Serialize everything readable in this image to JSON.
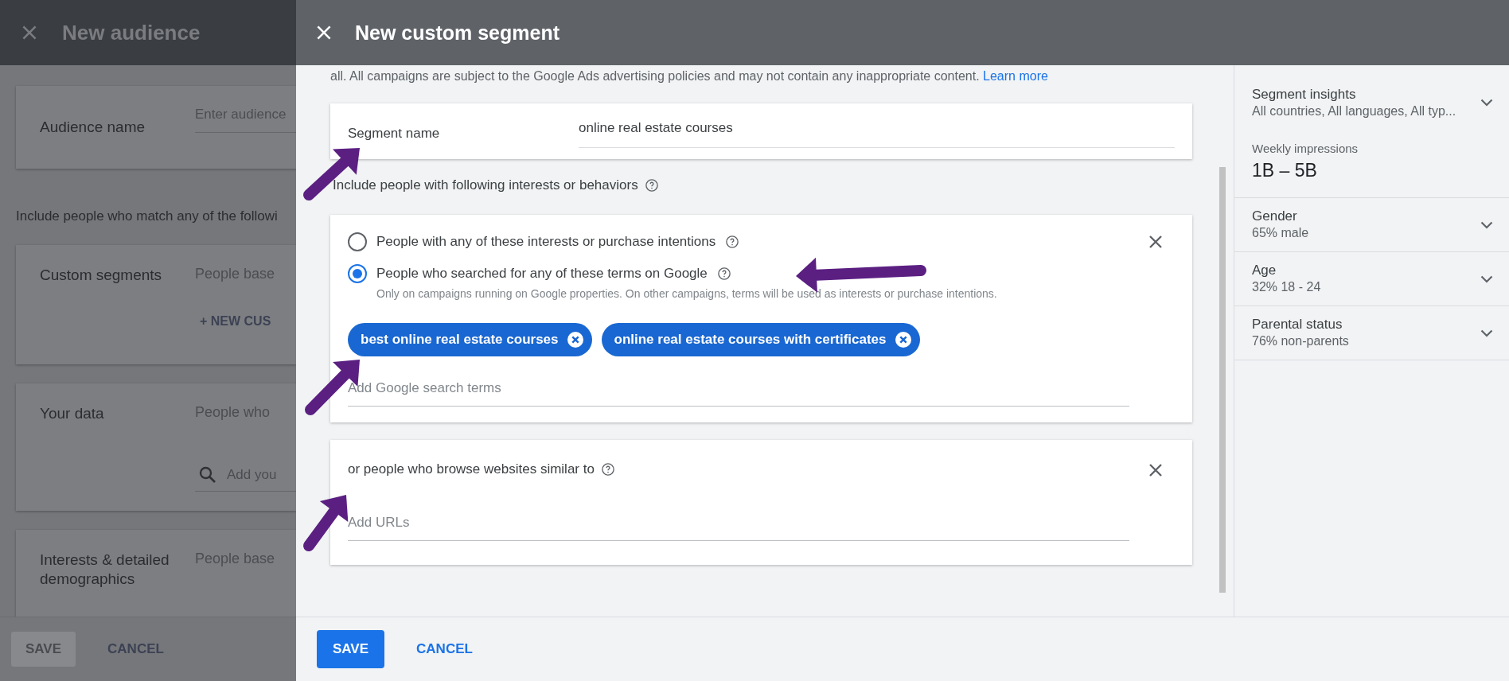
{
  "background_dialog": {
    "title": "New audience",
    "audience_name": {
      "label": "Audience name",
      "placeholder": "Enter audience"
    },
    "intro": "Include people who match any of the followi",
    "sections": [
      {
        "kind": "action",
        "label": "Custom segments",
        "description": "People base",
        "action": "+ NEW CUS"
      },
      {
        "kind": "search",
        "label": "Your data",
        "description": "People who",
        "placeholder": "Add you"
      },
      {
        "kind": "plain",
        "label": "Interests & detailed demographics",
        "description": "People base"
      }
    ],
    "buttons": [
      {
        "label": "SAVE",
        "disabled": true
      },
      {
        "label": "CANCEL",
        "disabled": false
      }
    ]
  },
  "dialog": {
    "title": "New custom segment",
    "notice": "all. All campaigns are subject to the Google Ads advertising policies and may not contain any inappropriate content.",
    "notice_link": "Learn more",
    "segment_name": {
      "label": "Segment name",
      "value": "online real estate courses"
    },
    "include_label": "Include people with following interests or behaviors",
    "interests_card": {
      "options": [
        {
          "label": "People with any of these interests or purchase intentions",
          "selected": false
        },
        {
          "label": "People who searched for any of these terms on Google",
          "selected": true
        }
      ],
      "note": "Only on campaigns running on Google properties. On other campaigns, terms will be used as interests or purchase intentions.",
      "terms": [
        "best online real estate courses",
        "online real estate courses with certificates"
      ],
      "placeholder": "Add Google search terms"
    },
    "websites_card": {
      "label": "or people who browse websites similar to",
      "placeholder": "Add URLs"
    },
    "insights": [
      {
        "kind": "summary",
        "title": "Segment insights",
        "value": "All countries, All languages, All typ..."
      },
      {
        "kind": "metric",
        "title": "Weekly impressions",
        "value": "1B – 5B"
      },
      {
        "kind": "summary",
        "title": "Gender",
        "value": "65% male"
      },
      {
        "kind": "summary",
        "title": "Age",
        "value": "32% 18 - 24"
      },
      {
        "kind": "summary",
        "title": "Parental status",
        "value": "76% non-parents"
      }
    ],
    "buttons": [
      {
        "kind": "primary",
        "label": "SAVE"
      },
      {
        "kind": "text",
        "label": "CANCEL"
      }
    ]
  }
}
